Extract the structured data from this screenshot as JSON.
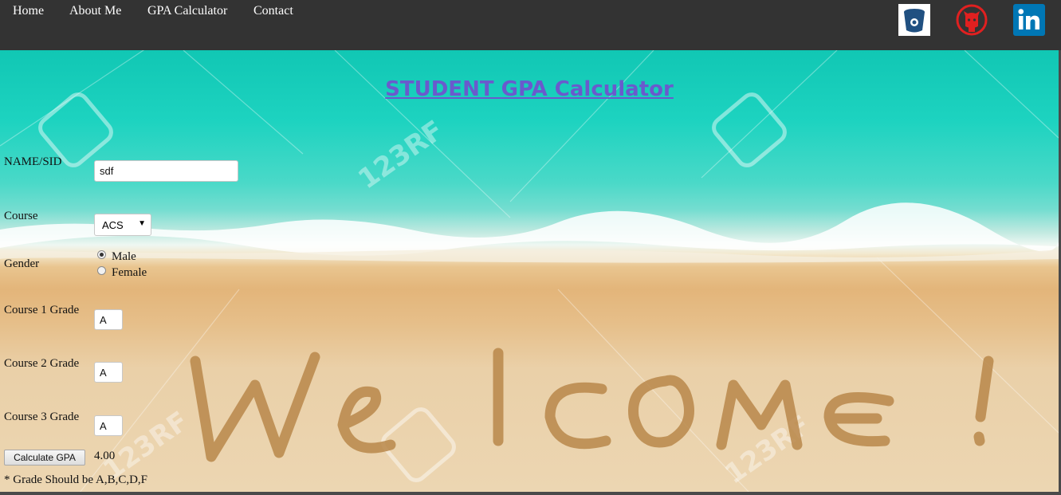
{
  "nav": {
    "links": [
      "Home",
      "About Me",
      "GPA Calculator",
      "Contact"
    ],
    "social": [
      {
        "icon": "bitbucket-icon",
        "color": "#205081"
      },
      {
        "icon": "github-icon",
        "color": "#e02020"
      },
      {
        "icon": "linkedin-icon",
        "color": "#0077b5"
      }
    ]
  },
  "page": {
    "title": "STUDENT GPA Calculator",
    "background_text": "Welcome!"
  },
  "form": {
    "name_label": "NAME/SID",
    "name_value": "sdf",
    "course_label": "Course",
    "course_selected": "ACS",
    "gender_label": "Gender",
    "gender_options": [
      "Male",
      "Female"
    ],
    "gender_selected": "Male",
    "grade1_label": "Course 1 Grade",
    "grade1_value": "A",
    "grade2_label": "Course 2 Grade",
    "grade2_value": "A",
    "grade3_label": "Course 3 Grade",
    "grade3_value": "A",
    "calc_button_label": "Calculate GPA",
    "gpa_result": "4.00",
    "note": "* Grade Should be A,B,C,D,F"
  },
  "colors": {
    "navbar": "#333333",
    "title": "#6a5acd"
  }
}
